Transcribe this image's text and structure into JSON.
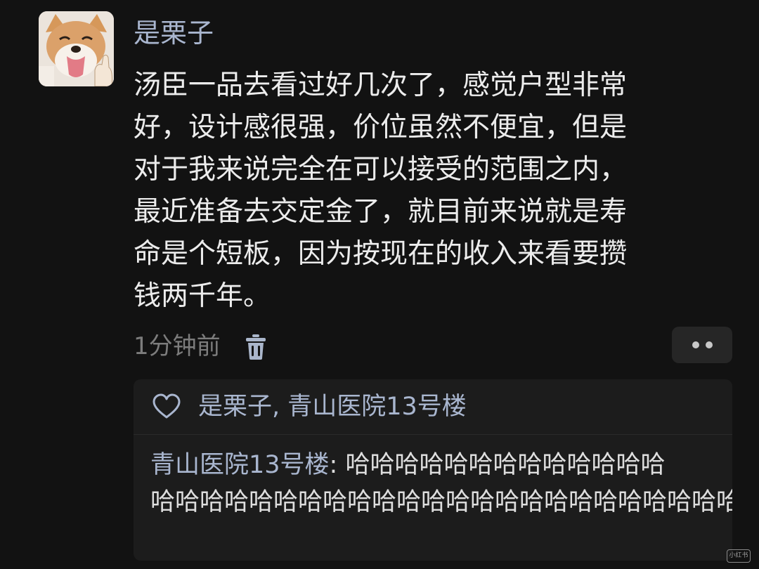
{
  "comment": {
    "username": "是栗子",
    "text": "汤臣一品去看过好几次了，感觉户型非常\n好，设计感很强，价位虽然不便宜，但是\n对于我来说完全在可以接受的范围之内，\n最近准备去交定金了，就目前来说就是寿\n命是个短板，因为按现在的收入来看要攒\n钱两千年。",
    "timestamp": "1分钟前",
    "avatar_icon": "shiba-dog-avatar",
    "delete_icon": "trash-icon",
    "more_icon": "more-dots-icon"
  },
  "replies": {
    "like_icon": "heart-outline-icon",
    "liked_by": "是栗子, 青山医院13号楼",
    "reply_author": "青山医院13号楼",
    "reply_separator": ": ",
    "reply_text": "哈哈哈哈哈哈哈哈哈哈哈哈哈\n哈哈哈哈哈哈哈哈哈哈哈哈哈哈哈哈哈哈哈哈哈哈哈哈哈哈哈哈哈哈哈哈哈哈哈哈哈哈哈哈"
  },
  "watermark": {
    "text": "小红书"
  },
  "colors": {
    "background": "#121212",
    "username": "#a9b6cf",
    "body_text": "#ececec",
    "muted_text": "#7c7c7c",
    "reply_box": "#1c1c1c"
  }
}
